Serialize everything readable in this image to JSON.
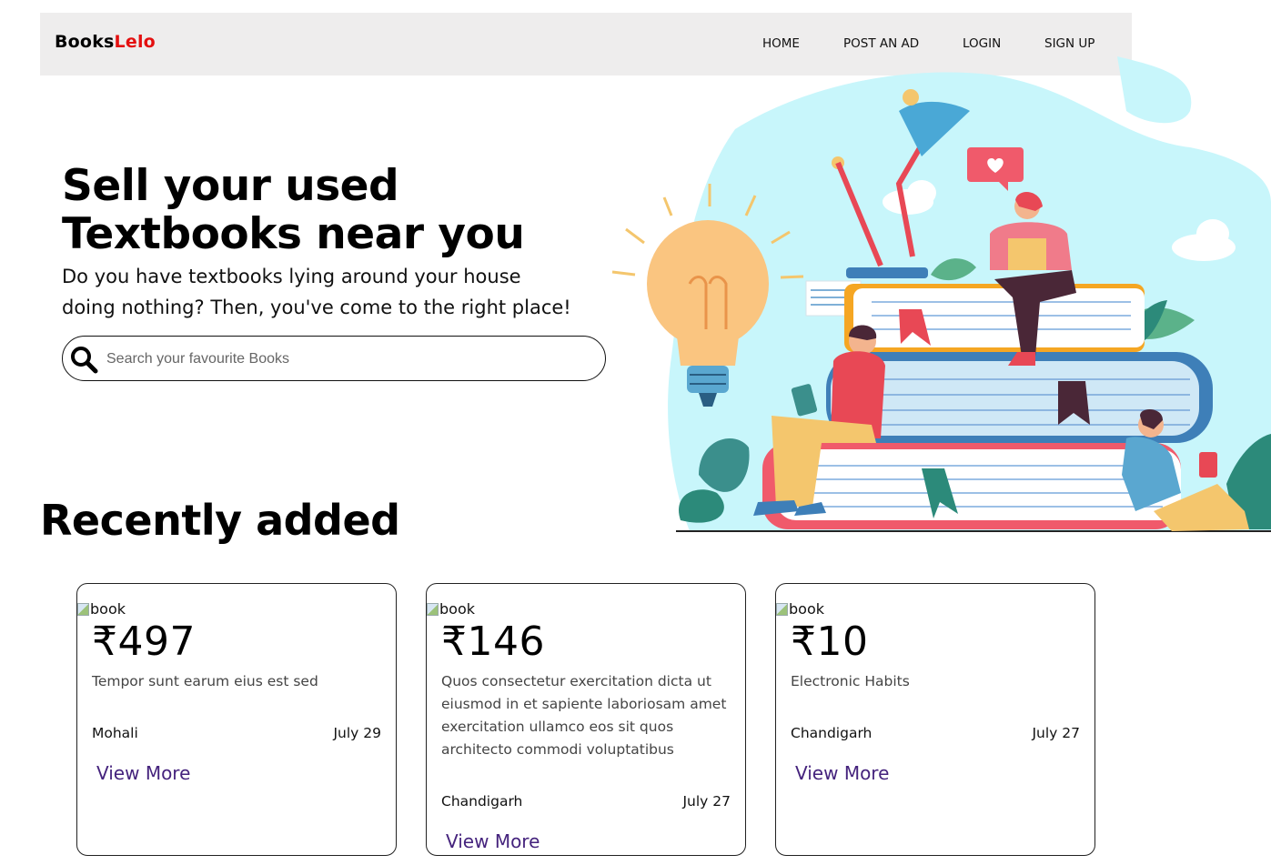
{
  "navbar": {
    "brand_part1": "Books",
    "brand_part2": "Lelo",
    "items": [
      "HOME",
      "POST AN AD",
      "LOGIN",
      "SIGN UP"
    ]
  },
  "hero": {
    "title_line1": "Sell your used",
    "title_line2": "Textbooks near you",
    "subtitle_line1": "Do you have textbooks lying around your house",
    "subtitle_line2": "doing nothing? Then, you've come to the right place!",
    "search_placeholder": "Search your favourite Books"
  },
  "recent": {
    "title": "Recently added",
    "cards": [
      {
        "img_alt": "book",
        "price": "₹497",
        "description": "Tempor sunt earum eius est sed",
        "location": "Mohali",
        "date": "July 29",
        "view_more": "View More"
      },
      {
        "img_alt": "book",
        "price": "₹146",
        "description": "Quos consectetur exercitation dicta ut eiusmod in et sapiente laboriosam amet exercitation ullamco eos sit quos architecto commodi voluptatibus",
        "location": "Chandigarh",
        "date": "July 27",
        "view_more": "View More"
      },
      {
        "img_alt": "book",
        "price": "₹10",
        "description": "Electronic Habits",
        "location": "Chandigarh",
        "date": "July 27",
        "view_more": "View More"
      }
    ]
  },
  "colors": {
    "brand_accent": "#e41010",
    "link": "#45237d",
    "navbar_bg": "#eeeded",
    "illustration_bg": "#c8f6fb"
  }
}
